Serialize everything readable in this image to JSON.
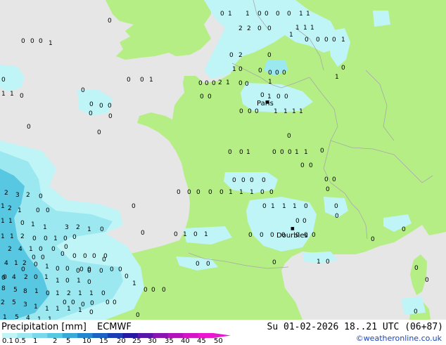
{
  "header": {
    "title": "Precipitation [mm]",
    "model": "ECMWF",
    "valid_time": "Su 01-02-2026 18..21 UTC (06+87)"
  },
  "credit": "©weatheronline.co.uk",
  "legend": {
    "ticks": [
      "0.1",
      "0.5",
      "1",
      "2",
      "5",
      "10",
      "15",
      "20",
      "25",
      "30",
      "35",
      "40",
      "45",
      "50"
    ],
    "colors": [
      "#bff5f7",
      "#9be8f0",
      "#7ad8ea",
      "#58c7e2",
      "#3aa9d7",
      "#2487cd",
      "#1b63c2",
      "#1a3db3",
      "#2519a4",
      "#5a16a8",
      "#8a15b0",
      "#b114ba",
      "#d415c6",
      "#e817d0"
    ]
  },
  "colors": {
    "sea": "#e6e6e6",
    "land": "#b4ee84",
    "border": "#a9a9a9",
    "precip_light": "#bff5f7",
    "precip_mid": "#9be8f0",
    "precip_heavy": "#58c7e2"
  },
  "cities": [
    {
      "name": "Paris"
    },
    {
      "name": "Dourbies"
    }
  ],
  "map_labels": [
    "0",
    "1",
    "1",
    "0",
    "0",
    "0",
    "0",
    "1",
    "1",
    "2",
    "2",
    "0",
    "0",
    "1",
    "1",
    "1",
    "0",
    "0",
    "0",
    "0",
    "1",
    "1",
    "0",
    "2",
    "0",
    "1",
    "0",
    "0",
    "0",
    "0",
    "0",
    "0",
    "1",
    "0",
    "0",
    "0",
    "2",
    "1",
    "1",
    "0",
    "0",
    "0",
    "0",
    "1",
    "0",
    "0",
    "0",
    "1",
    "0",
    "0",
    "0",
    "0",
    "0",
    "1",
    "1",
    "1",
    "1",
    "0",
    "0",
    "0",
    "0",
    "0",
    "0",
    "0",
    "1",
    "0",
    "1",
    "1",
    "0",
    "0",
    "0",
    "0",
    "0",
    "0",
    "0",
    "0",
    "0",
    "1",
    "0",
    "0",
    "0",
    "1",
    "1",
    "0",
    "0",
    "0",
    "0",
    "0",
    "0",
    "0",
    "0",
    "1",
    "1",
    "1",
    "0",
    "0",
    "0",
    "0",
    "0",
    "0",
    "0",
    "0",
    "0",
    "0",
    "0",
    "1",
    "1",
    "1",
    "0",
    "0",
    "0",
    "0",
    "0",
    "0",
    "0",
    "0",
    "0",
    "0",
    "1",
    "0",
    "1",
    "0",
    "0",
    "0",
    "0",
    "0",
    "0",
    "0",
    "1",
    "0",
    "0",
    "0",
    "0",
    "0",
    "0",
    "0",
    "0",
    "0",
    "0",
    "0",
    "0",
    "0",
    "0",
    "0",
    "0",
    "0",
    "0",
    "0",
    "0",
    "1",
    "0",
    "0",
    "0",
    "0",
    "0",
    "0",
    "0",
    "0",
    "2",
    "3",
    "2",
    "0",
    "1",
    "2",
    "1",
    "0",
    "0",
    "1",
    "1",
    "0",
    "1",
    "1",
    "3",
    "2",
    "1",
    "0",
    "1",
    "1",
    "2",
    "0",
    "0",
    "1",
    "0",
    "2",
    "4",
    "1",
    "0",
    "0",
    "0",
    "0",
    "0",
    "0",
    "0",
    "4",
    "1",
    "2",
    "0",
    "1",
    "0",
    "0",
    "0",
    "0",
    "0",
    "0",
    "4",
    "2",
    "0",
    "1",
    "1",
    "0",
    "1",
    "0",
    "8",
    "5",
    "8",
    "1",
    "0",
    "1",
    "2",
    "1",
    "1",
    "0",
    "2",
    "5",
    "3",
    "1",
    "1",
    "1",
    "1",
    "1",
    "0",
    "1",
    "5",
    "4",
    "1",
    "1"
  ]
}
